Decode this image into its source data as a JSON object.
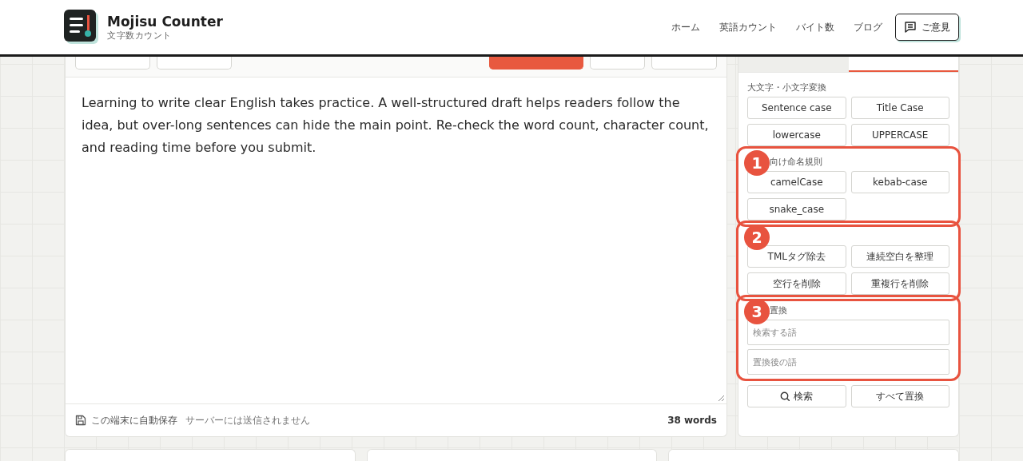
{
  "header": {
    "logo_title": "Mojisu Counter",
    "logo_subtitle": "文字数カウント",
    "nav": [
      {
        "label": "ホーム"
      },
      {
        "label": "英語カウント"
      },
      {
        "label": "バイト数"
      },
      {
        "label": "ブログ"
      }
    ],
    "feedback_button": "ご意見"
  },
  "editor": {
    "toolbar_left": [
      {
        "kind": "plain"
      },
      {
        "kind": "plain"
      }
    ],
    "toolbar_right": [
      {
        "kind": "primary"
      },
      {
        "kind": "plain"
      },
      {
        "kind": "plain"
      }
    ],
    "text": "Learning to write clear English takes practice. A well-structured draft helps readers follow the idea, but over-long sentences can hide the main point. Re-check the word count, character count, and reading time before you submit.",
    "footer_save": "この端末に自動保存",
    "footer_note": "サーバーには送信されません",
    "word_count": "38 words"
  },
  "tools": {
    "tabs": [
      {
        "selected": false
      },
      {
        "selected": true
      }
    ],
    "sections": [
      {
        "label": "大文字・小文字変換",
        "buttons": [
          {
            "label": "Sentence case"
          },
          {
            "label": "Title Case"
          },
          {
            "label": "lowercase"
          },
          {
            "label": "UPPERCASE"
          }
        ]
      },
      {
        "label": "向け命名規則",
        "annotation": "1",
        "buttons": [
          {
            "label": "camelCase"
          },
          {
            "label": "kebab-case"
          },
          {
            "label": "snake_case"
          }
        ]
      },
      {
        "annotation": "2",
        "buttons": [
          {
            "label": "TMLタグ除去"
          },
          {
            "label": "連続空白を整理"
          },
          {
            "label": "空行を削除"
          },
          {
            "label": "重複行を削除"
          }
        ]
      },
      {
        "label": "置換",
        "annotation": "3",
        "fields": [
          {
            "placeholder": "検索する語"
          },
          {
            "placeholder": "置換後の語"
          }
        ]
      },
      {
        "buttons": [
          {
            "label": "検索",
            "kind": "search"
          },
          {
            "label": "すべて置換",
            "kind": "plain"
          }
        ]
      }
    ]
  }
}
